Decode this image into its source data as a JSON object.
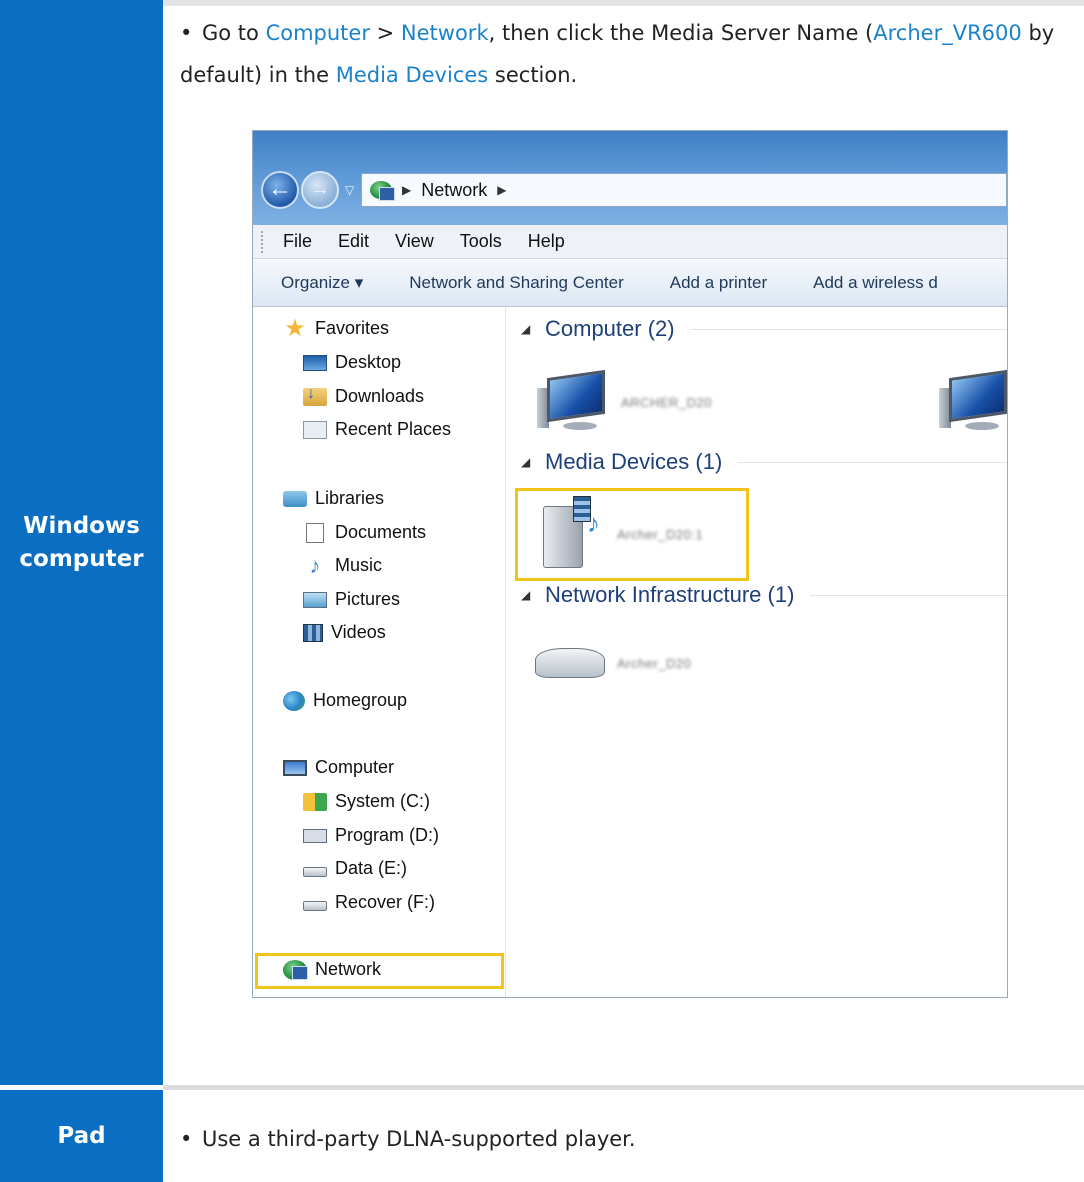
{
  "rows": [
    {
      "label": "Windows computer",
      "label_lines": [
        "Windows",
        "computer"
      ],
      "instruction_parts": {
        "prefix": "Go to ",
        "link1": "Computer",
        "sep": " > ",
        "link2": "Network",
        "mid": ", then click the Media Server Name (",
        "link3": "Archer_VR600",
        "mid2": " by default) in the ",
        "link4": "Media Devices",
        "suffix": " section."
      }
    },
    {
      "label": "Pad",
      "instruction": "Use a third-party DLNA-supported player."
    }
  ],
  "explorer": {
    "address_crumb": "Network",
    "menu": [
      "File",
      "Edit",
      "View",
      "Tools",
      "Help"
    ],
    "toolbar": [
      "Organize ▾",
      "Network and Sharing Center",
      "Add a printer",
      "Add a wireless d"
    ],
    "nav": {
      "favorites": "Favorites",
      "desktop": "Desktop",
      "downloads": "Downloads",
      "recent": "Recent Places",
      "libraries": "Libraries",
      "documents": "Documents",
      "music": "Music",
      "pictures": "Pictures",
      "videos": "Videos",
      "homegroup": "Homegroup",
      "computer": "Computer",
      "system": "System (C:)",
      "program": "Program (D:)",
      "data": "Data (E:)",
      "recover": "Recover (F:)",
      "network": "Network"
    },
    "groups": {
      "computer": "Computer (2)",
      "media": "Media Devices (1)",
      "infra": "Network Infrastructure (1)"
    },
    "devices": {
      "computer1": "ARCHER_D20",
      "media1": "Archer_D20:1",
      "router1": "Archer_D20"
    }
  },
  "colors": {
    "label_bg": "#0a6fc2",
    "link": "#1b82cc",
    "highlight": "#f2c318"
  }
}
